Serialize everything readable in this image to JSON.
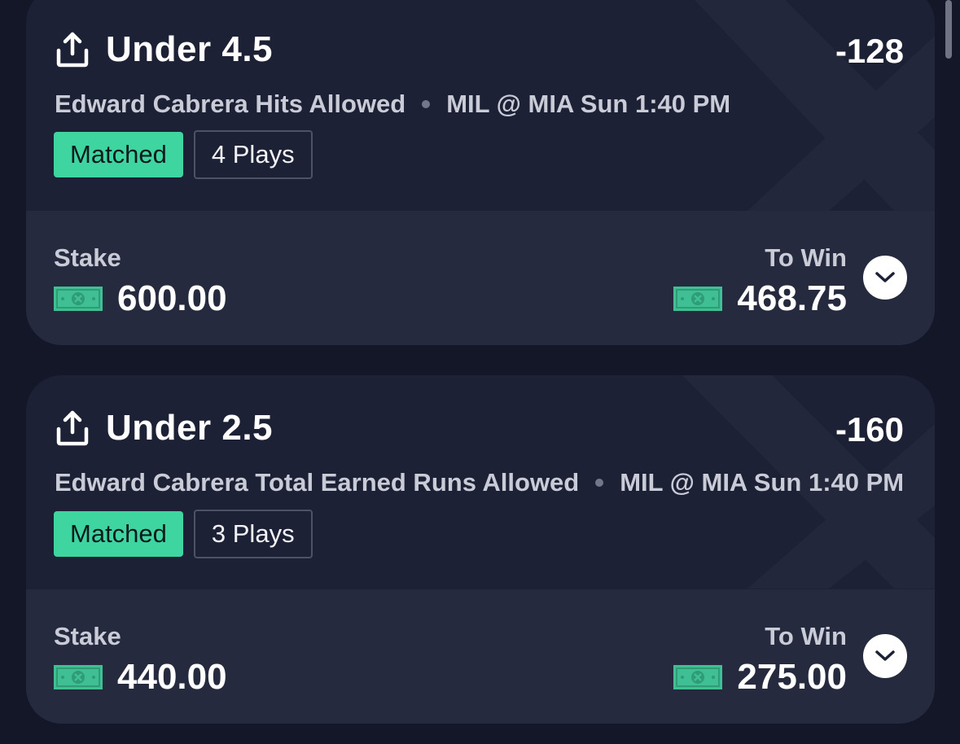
{
  "colors": {
    "background": "#141728",
    "card": "#1d2135",
    "card_footer": "#262a3f",
    "matched_badge": "#3ed5a0",
    "cash_green": "#3fbf93"
  },
  "icons": {
    "share": "share-icon",
    "cash": "cash-icon",
    "expand": "chevron-down-icon"
  },
  "bets": [
    {
      "title": "Under 4.5",
      "odds": "-128",
      "market": "Edward Cabrera Hits Allowed",
      "game": "MIL @ MIA Sun 1:40 PM",
      "status": "Matched",
      "plays": "4 Plays",
      "stake_label": "Stake",
      "stake": "600.00",
      "to_win_label": "To Win",
      "to_win": "468.75"
    },
    {
      "title": "Under 2.5",
      "odds": "-160",
      "market": "Edward Cabrera Total Earned Runs Allowed",
      "game": "MIL @ MIA Sun 1:40 PM",
      "status": "Matched",
      "plays": "3 Plays",
      "stake_label": "Stake",
      "stake": "440.00",
      "to_win_label": "To Win",
      "to_win": "275.00"
    }
  ]
}
